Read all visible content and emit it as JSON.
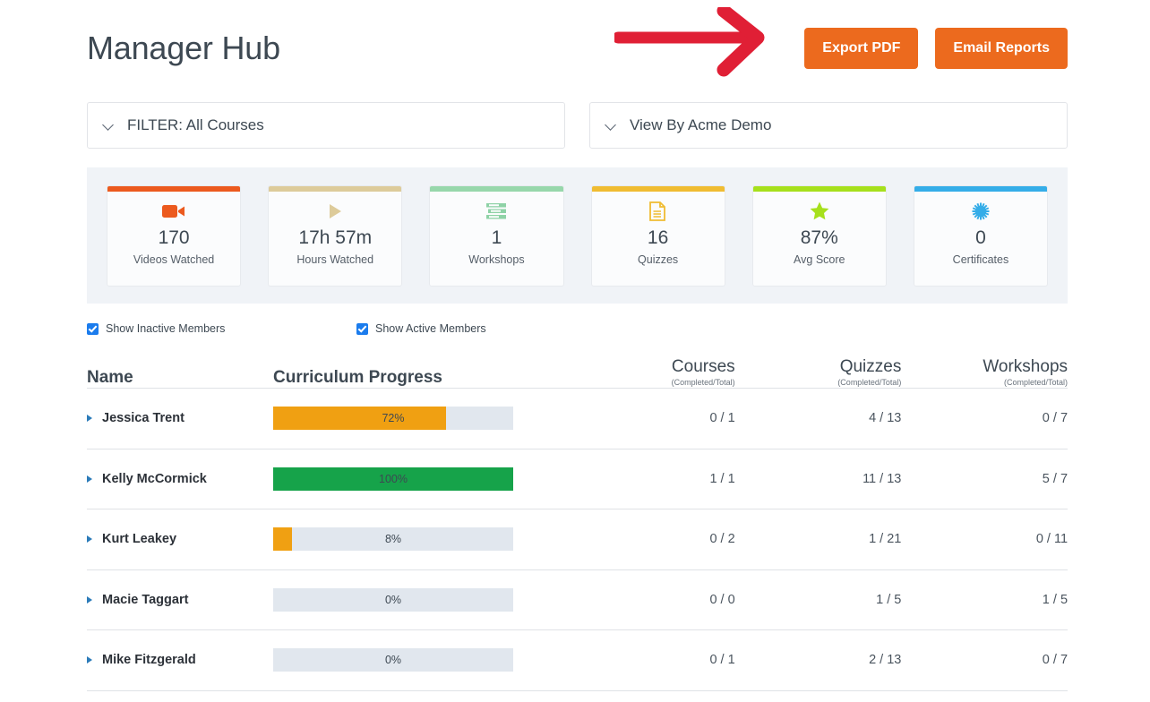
{
  "header": {
    "title": "Manager Hub",
    "buttons": [
      {
        "label": "Export PDF",
        "name": "export-pdf-button"
      },
      {
        "label": "Email Reports",
        "name": "email-reports-button"
      }
    ],
    "accent_color": "#ec6a1e",
    "annotation_arrow_color": "#e01f35"
  },
  "filters": [
    {
      "label": "FILTER: All Courses",
      "name": "filter-courses-dropdown"
    },
    {
      "label": "View By Acme Demo",
      "name": "view-by-dropdown"
    }
  ],
  "stats": [
    {
      "value": "170",
      "label": "Videos Watched",
      "icon": "video-camera-icon",
      "color": "#ec5a1e"
    },
    {
      "value": "17h 57m",
      "label": "Hours Watched",
      "icon": "play-triangle-icon",
      "color": "#ddcb9a"
    },
    {
      "value": "1",
      "label": "Workshops",
      "icon": "list-stack-icon",
      "color": "#97d7ab"
    },
    {
      "value": "16",
      "label": "Quizzes",
      "icon": "document-icon",
      "color": "#f0bc32"
    },
    {
      "value": "87%",
      "label": "Avg Score",
      "icon": "star-icon",
      "color": "#a6e01c"
    },
    {
      "value": "0",
      "label": "Certificates",
      "icon": "certificate-seal-icon",
      "color": "#35ade8"
    }
  ],
  "checkboxes": [
    {
      "label": "Show Inactive Members",
      "checked": true,
      "name": "show-inactive-members-checkbox"
    },
    {
      "label": "Show Active Members",
      "checked": true,
      "name": "show-active-members-checkbox"
    }
  ],
  "table": {
    "headers": {
      "name": "Name",
      "progress": "Curriculum Progress",
      "courses": "Courses",
      "quizzes": "Quizzes",
      "workshops": "Workshops",
      "sub": "(Completed/Total)"
    },
    "rows": [
      {
        "name": "Jessica Trent",
        "progress_pct": 72,
        "progress_label": "72%",
        "bar_color": "#f0a012",
        "courses": "0 / 1",
        "quizzes": "4 / 13",
        "workshops": "0 / 7"
      },
      {
        "name": "Kelly McCormick",
        "progress_pct": 100,
        "progress_label": "100%",
        "bar_color": "#16a34a",
        "courses": "1 / 1",
        "quizzes": "11 / 13",
        "workshops": "5 / 7"
      },
      {
        "name": "Kurt Leakey",
        "progress_pct": 8,
        "progress_label": "8%",
        "bar_color": "#f0a012",
        "courses": "0 / 2",
        "quizzes": "1 / 21",
        "workshops": "0 / 11"
      },
      {
        "name": "Macie Taggart",
        "progress_pct": 0,
        "progress_label": "0%",
        "bar_color": "#f0a012",
        "courses": "0 / 0",
        "quizzes": "1 / 5",
        "workshops": "1 / 5"
      },
      {
        "name": "Mike Fitzgerald",
        "progress_pct": 0,
        "progress_label": "0%",
        "bar_color": "#f0a012",
        "courses": "0 / 1",
        "quizzes": "2 / 13",
        "workshops": "0 / 7"
      }
    ]
  }
}
